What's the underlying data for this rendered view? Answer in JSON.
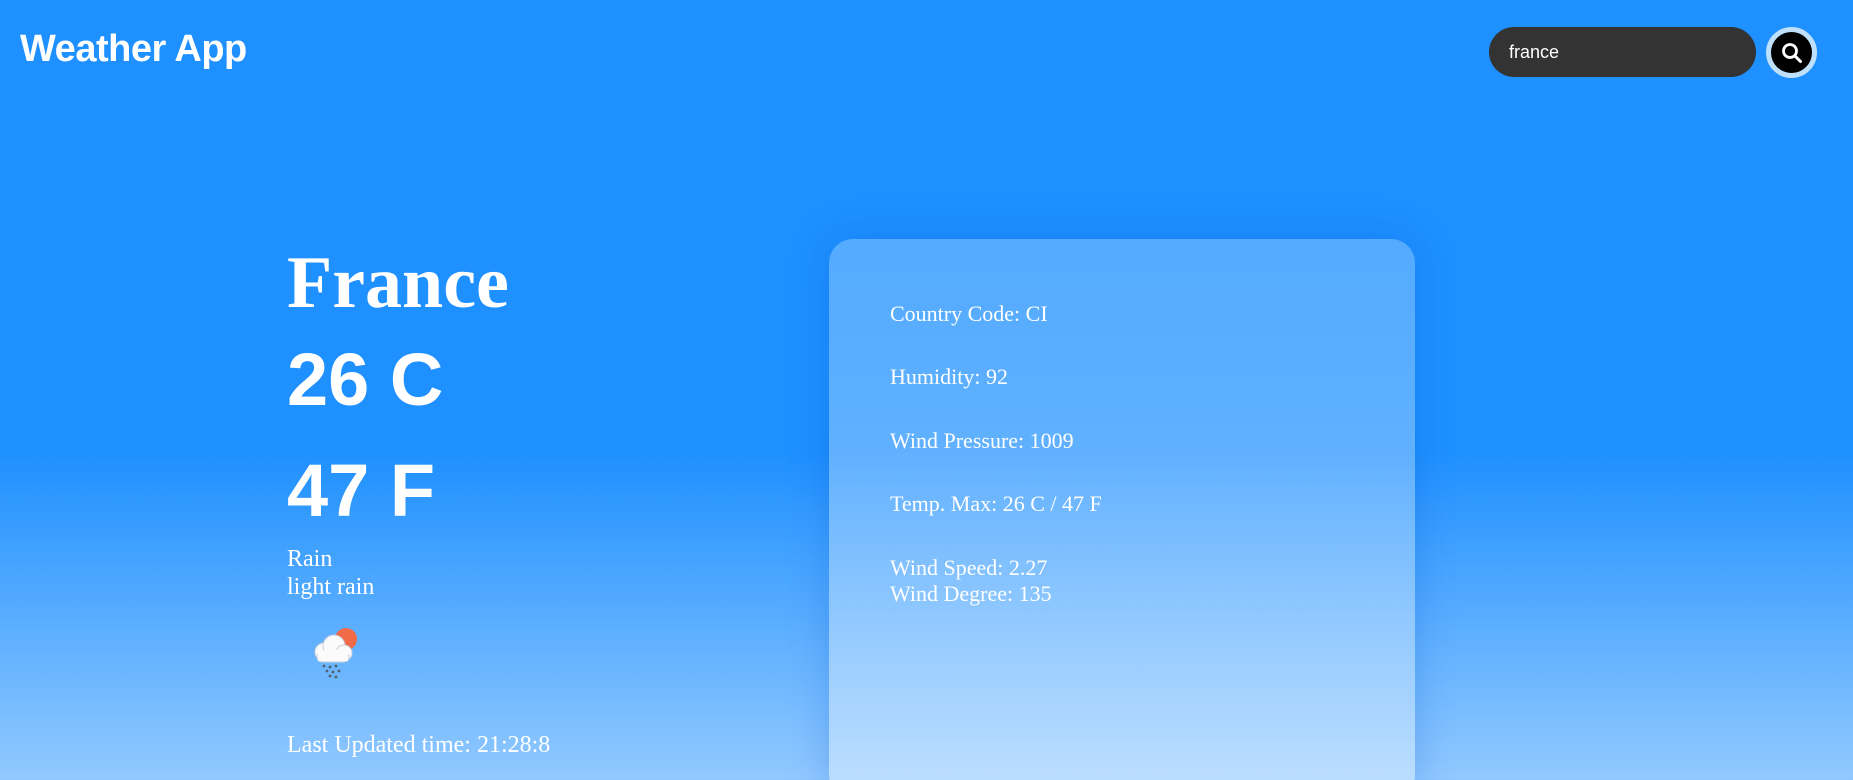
{
  "header": {
    "title": "Weather App",
    "search": {
      "value": "france"
    }
  },
  "weather": {
    "city": "France",
    "temp_c": "26 C",
    "temp_f": "47 F",
    "condition": "Rain",
    "description": "light rain",
    "icon": "rain-cloud-sun-icon",
    "last_updated": "Last Updated time: 21:28:8"
  },
  "details": {
    "country_code": "Country Code: CI",
    "humidity": "Humidity: 92",
    "wind_pressure": "Wind Pressure: 1009",
    "temp_max": "Temp. Max: 26 C / 47 F",
    "wind_speed": "Wind Speed: 2.27",
    "wind_degree": "Wind Degree: 135"
  },
  "colors": {
    "background_top": "#1e90ff",
    "background_bottom": "#92c9ff",
    "search_bg": "#333333"
  }
}
